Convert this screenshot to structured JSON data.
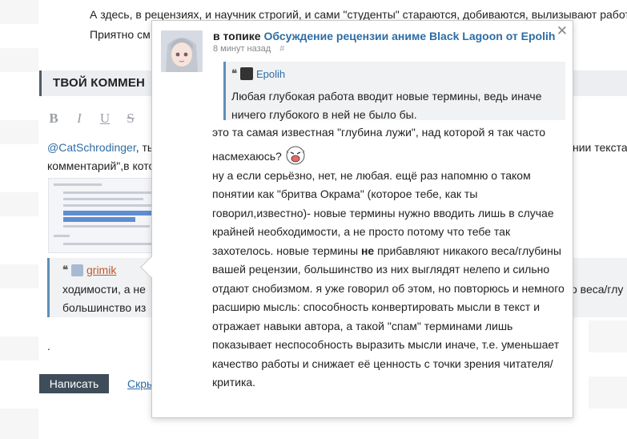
{
  "background": {
    "line1": "А здесь, в рецензиях, и научник строгий, и сами \"студенты\" стараются, добиваются, вылизывают работ",
    "line2": "Приятно см",
    "comment_header": "ТВОЙ КОММЕН",
    "toolbar": [
      "B",
      "I",
      "U",
      "S"
    ],
    "mention": "@CatSchrodinger",
    "mention_suffix": ", ть",
    "mention_right": "нии текста,",
    "comment_line2": "комментарий\",в кото",
    "quote_author": "grimik",
    "quote_line1_left": "ходимости, а не",
    "quote_line1_right": "о веса/глу",
    "quote_line2_left": "большинство из",
    "dot": ".",
    "write_button": "Написать",
    "hide_link": "Скры"
  },
  "popup": {
    "topic_prefix": "в топике",
    "topic_title": "Обсуждение рецензии аниме Black Lagoon от Epolih",
    "time_ago": "8 минут назад",
    "hash": "#",
    "quote": {
      "author": "Epolih",
      "text": "Любая глубокая работа вводит новые термины, ведь иначе ничего глубокого в ней не было бы."
    },
    "body": {
      "p1": "это та самая известная \"глубина лужи\", над которой я так часто насмехаюсь?",
      "p2_before_bold": "ну а если серьёзно, нет, не любая. ещё раз напомню о таком понятии как \"бритва Окрама\" (которое тебе, как ты говорил,известно)- новые термины нужно вводить лишь в случае крайней необходимости, а не просто потому что тебе так захотелось. новые термины ",
      "p2_bold": "не",
      "p2_after_bold": " прибавляют никакого веса/глубины вашей рецензии, большинство из них выглядят нелепо и сильно отдают снобизмом. я уже говорил об этом, но повторюсь и немного расширю мысль: способность конвертировать мысли в текст и отражает навыки автора, а такой \"спам\" терминами лишь показывает неспособность выразить мысли иначе, т.е. уменьшает качество работы и снижает её ценность с точки зрения читателя/критика."
    }
  }
}
